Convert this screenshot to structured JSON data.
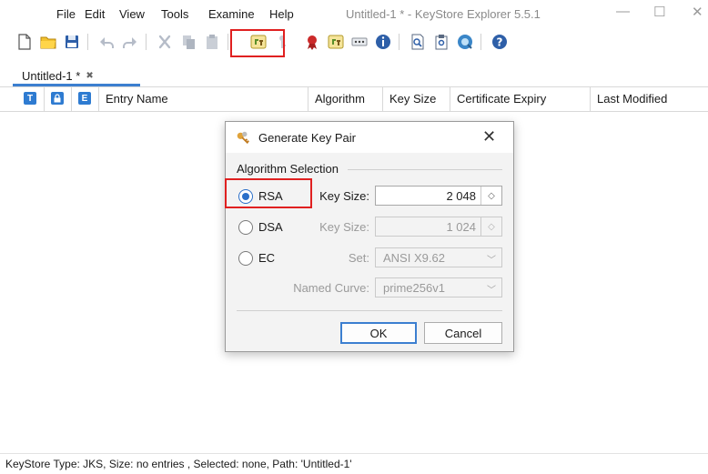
{
  "menu": [
    "File",
    "Edit",
    "View",
    "Tools",
    "Examine",
    "Help"
  ],
  "window": {
    "title": "Untitled-1 * - KeyStore Explorer 5.5.1",
    "minimize": "—",
    "maximize": "☐",
    "close": "✕"
  },
  "tab": {
    "label": "Untitled-1 *",
    "close": "✖"
  },
  "table": {
    "icon_t": "T",
    "icon_e": "E",
    "columns": [
      "Entry Name",
      "Algorithm",
      "Key Size",
      "Certificate Expiry",
      "Last Modified"
    ]
  },
  "status": "KeyStore Type: JKS, Size: no entries , Selected: none, Path: 'Untitled-1'",
  "dialog": {
    "title": "Generate Key Pair",
    "close": "✕",
    "group_label": "Algorithm Selection",
    "rsa": {
      "label": "RSA",
      "key_size_label": "Key Size:",
      "key_size": "2 048",
      "selected": true
    },
    "dsa": {
      "label": "DSA",
      "key_size_label": "Key Size:",
      "key_size": "1 024",
      "selected": false
    },
    "ec": {
      "label": "EC",
      "set_label": "Set:",
      "set_value": "ANSI X9.62",
      "curve_label": "Named Curve:",
      "curve_value": "prime256v1",
      "selected": false
    },
    "ok": "OK",
    "cancel": "Cancel"
  },
  "colors": {
    "accent": "#3c7fd0",
    "highlight": "#e02020"
  },
  "icons": {
    "toolbar": [
      "new-keystore-icon",
      "open-keystore-icon",
      "save-keystore-icon",
      "undo-icon",
      "redo-icon",
      "cut-icon",
      "copy-icon",
      "paste-icon",
      "generate-key-pair-icon",
      "generate-secret-key-icon",
      "import-trusted-certificate-icon",
      "import-key-pair-icon",
      "set-password-icon",
      "properties-icon",
      "examine-file-icon",
      "examine-clipboard-icon",
      "examine-ssl-icon",
      "help-icon"
    ]
  }
}
